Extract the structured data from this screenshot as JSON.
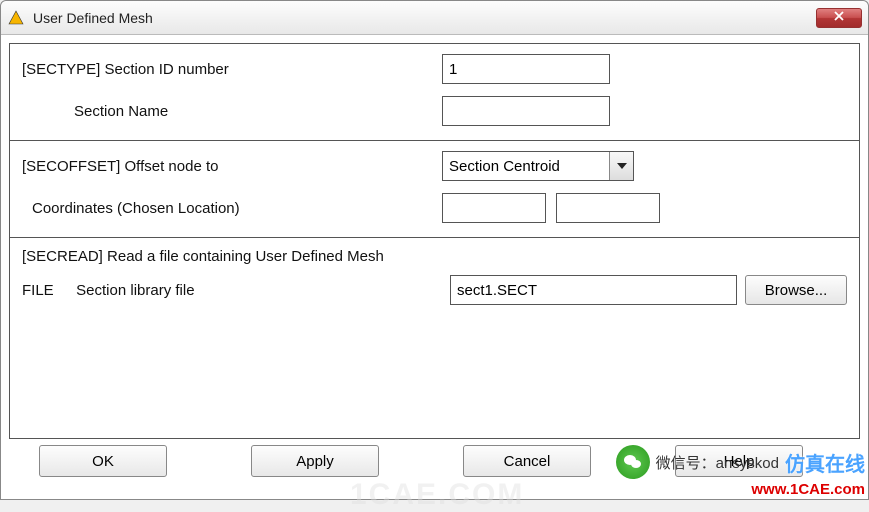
{
  "window": {
    "title": "User Defined Mesh"
  },
  "sec1": {
    "sectype_label": "[SECTYPE] Section ID number",
    "sectype_value": "1",
    "secname_label": "Section Name",
    "secname_value": ""
  },
  "sec2": {
    "offset_label": "[SECOFFSET] Offset node to",
    "offset_value": "Section Centroid",
    "coord_label": "Coordinates (Chosen Location)",
    "coord_x": "",
    "coord_y": ""
  },
  "sec3": {
    "header": "[SECREAD]   Read a file containing User Defined Mesh",
    "file_key": "FILE",
    "file_label": "Section library file",
    "file_value": "sect1.SECT",
    "browse": "Browse..."
  },
  "buttons": {
    "ok": "OK",
    "apply": "Apply",
    "cancel": "Cancel",
    "help": "Help"
  },
  "watermark": "1CAE.COM",
  "overlay": {
    "wechat": "微信号：ansyskod",
    "brand": "仿真在线",
    "url": "www.1CAE.com"
  }
}
